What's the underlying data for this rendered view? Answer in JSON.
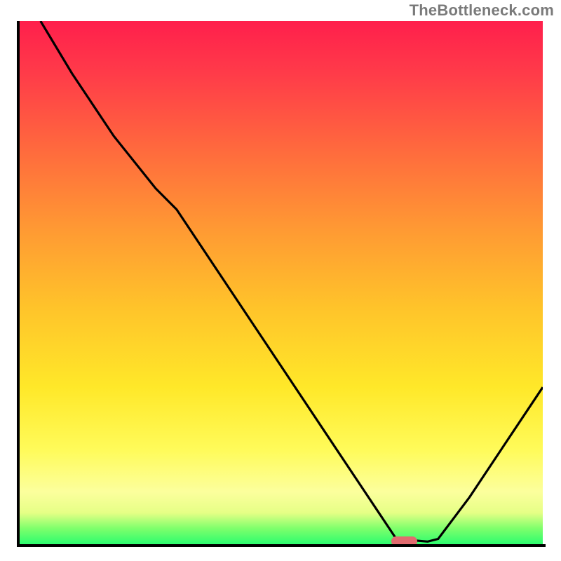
{
  "watermark": "TheBottleneck.com",
  "chart_data": {
    "type": "line",
    "title": "",
    "xlabel": "",
    "ylabel": "",
    "xlim": [
      0,
      100
    ],
    "ylim": [
      0,
      100
    ],
    "grid": false,
    "curve_description": "bottleneck-style V curve descending from top-left to a flat minimum near x≈72–80 then rising toward the right edge",
    "x": [
      4,
      10,
      18,
      26,
      30,
      40,
      50,
      60,
      68,
      72,
      78,
      80,
      86,
      92,
      100
    ],
    "values": [
      100,
      90,
      78,
      68,
      64,
      49,
      34,
      19,
      7,
      1,
      0.5,
      1,
      9,
      18,
      30
    ],
    "marker": {
      "x_range": [
        71,
        76
      ],
      "y": 0.6
    },
    "background_gradient": {
      "top_color": "#ff1f4c",
      "mid_color": "#ffe829",
      "bottom_color": "#2cfc6e"
    }
  }
}
